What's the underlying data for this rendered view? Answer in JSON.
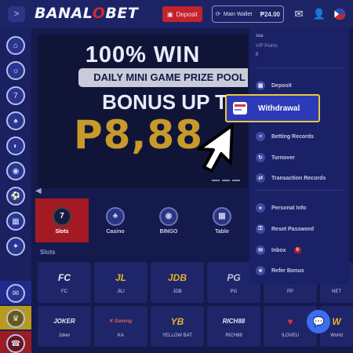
{
  "header": {
    "logo_left": "BANAL",
    "logo_o": "O",
    "logo_right": "BET",
    "deposit_label": "Deposit",
    "wallet_label": "Main Wallet",
    "wallet_amount": "₱24.00",
    "icons": [
      "sidebar-expand-icon",
      "mail-icon",
      "user-icon",
      "philippines-flag-icon"
    ]
  },
  "banner": {
    "line1": "100% WIN",
    "line2": "DAILY MINI GAME PRIZE POOL",
    "line3": "BONUS UP TO",
    "line4": "P8,88"
  },
  "categories": [
    {
      "label": "Slots",
      "icon": "7",
      "active": true
    },
    {
      "label": "Casino",
      "icon": "♣",
      "active": false
    },
    {
      "label": "BINGO",
      "icon": "◉",
      "active": false
    },
    {
      "label": "Table",
      "icon": "▦",
      "active": false
    }
  ],
  "section_title": "Slots",
  "tiles": [
    {
      "logo": "FC",
      "name": "FC"
    },
    {
      "logo": "JL",
      "name": "JILI"
    },
    {
      "logo": "JDB",
      "name": "JDB"
    },
    {
      "logo": "PG",
      "name": "PG"
    },
    {
      "logo": "",
      "name": "PP"
    },
    {
      "logo": "",
      "name": "NET"
    },
    {
      "logo": "JOKER",
      "name": "Joker"
    },
    {
      "logo": "K Gaming",
      "name": "KA"
    },
    {
      "logo": "YB",
      "name": "YELLOW BAT"
    },
    {
      "logo": "RICH88",
      "name": "RICH88"
    },
    {
      "logo": "♥",
      "name": "ILOVEU"
    },
    {
      "logo": "W",
      "name": "World"
    }
  ],
  "menu": {
    "username": "ssa",
    "vip_label": "VIP Points",
    "vip_value": "0",
    "items": [
      {
        "label": "Deposit",
        "icon": "deposit-icon"
      },
      {
        "label": "Withdrawal",
        "icon": "withdrawal-icon"
      },
      {
        "label": "Betting Records",
        "icon": "betting-records-icon"
      },
      {
        "label": "Turnover",
        "icon": "turnover-icon"
      },
      {
        "label": "Transaction Records",
        "icon": "transaction-records-icon"
      },
      {
        "label": "Personal Info",
        "icon": "personal-info-icon"
      },
      {
        "label": "Reset Password",
        "icon": "reset-password-icon"
      },
      {
        "label": "Inbox",
        "icon": "inbox-icon",
        "badge": "0"
      },
      {
        "label": "Refer Bonus",
        "icon": "refer-bonus-icon"
      }
    ]
  },
  "colors": {
    "highlight_border": "#e8c93e",
    "active_category": "#a31a22",
    "menu_bg": "#1a2166"
  }
}
